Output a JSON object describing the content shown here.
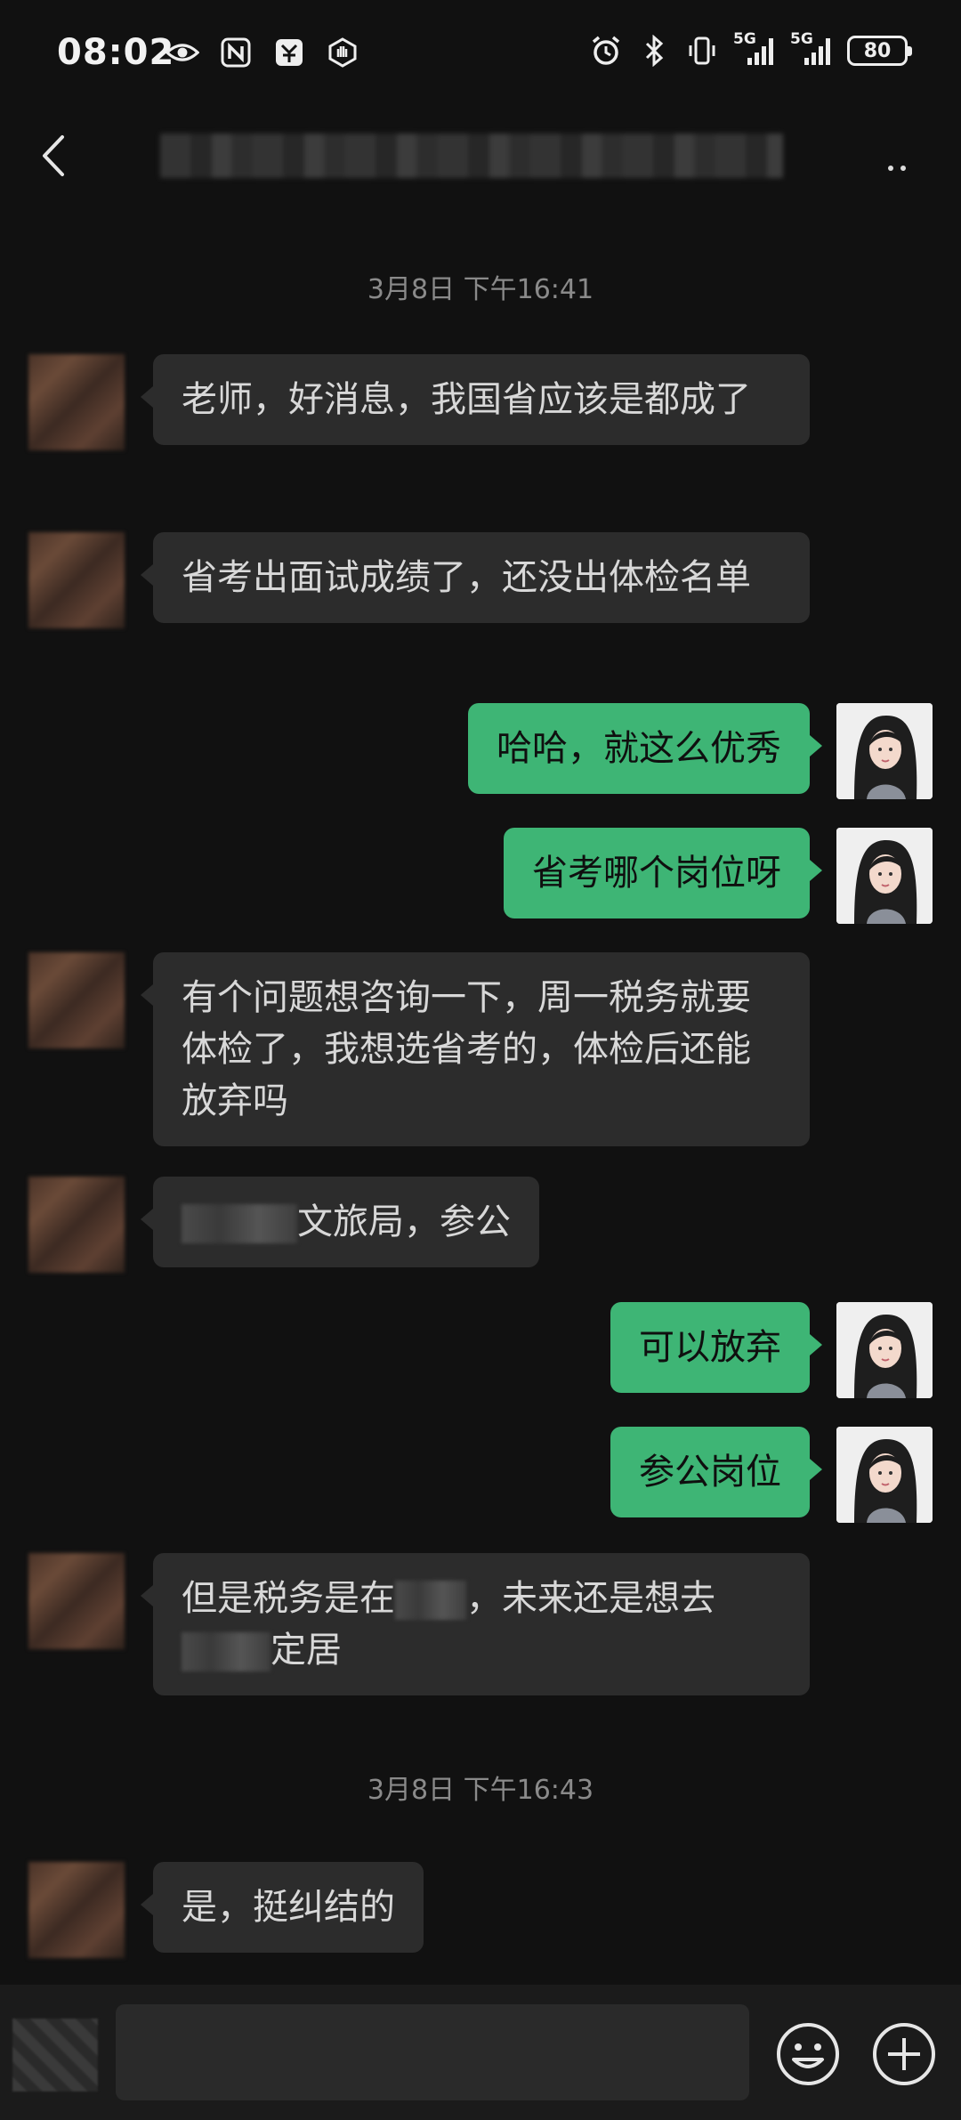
{
  "status_bar": {
    "time": "08:02",
    "battery": "80",
    "signal_1": "5G",
    "signal_2": "5G",
    "icons_left": [
      "eye-icon",
      "nfc-icon",
      "app-icon",
      "hand-icon"
    ],
    "icons_right": [
      "alarm-icon",
      "bluetooth-icon",
      "vibrate-icon",
      "signal-icon",
      "signal-icon",
      "battery-icon"
    ]
  },
  "header": {
    "back_icon": "chevron-left-icon",
    "more_icon": "more-dots-icon"
  },
  "timestamps": [
    "3月8日 下午16:41",
    "3月8日 下午16:43"
  ],
  "messages": [
    {
      "side": "left",
      "text": "老师，好消息，我国省应该是都成了"
    },
    {
      "side": "left",
      "text": "省考出面试成绩了，还没出体检名单"
    },
    {
      "side": "right",
      "text": "哈哈，就这么优秀"
    },
    {
      "side": "right",
      "text": "省考哪个岗位呀"
    },
    {
      "side": "left",
      "text": "有个问题想咨询一下，周一税务就要体检了，我想选省考的，体检后还能放弃吗"
    },
    {
      "side": "left",
      "text": "文旅局，参公"
    },
    {
      "side": "right",
      "text": "可以放弃"
    },
    {
      "side": "right",
      "text": "参公岗位"
    },
    {
      "side": "left",
      "text_part1": "但是税务是在",
      "text_part2": "，未来还是想去",
      "text_part3": "定居"
    },
    {
      "side": "left",
      "text": "是，挺纠结的"
    }
  ],
  "input_bar": {
    "value": "",
    "emoji_icon": "emoji-icon",
    "plus_icon": "plus-icon"
  },
  "colors": {
    "background": "#111111",
    "bubble_left": "#2c2c2c",
    "bubble_right": "#3eb575",
    "timestamp": "#8a8a8a"
  }
}
